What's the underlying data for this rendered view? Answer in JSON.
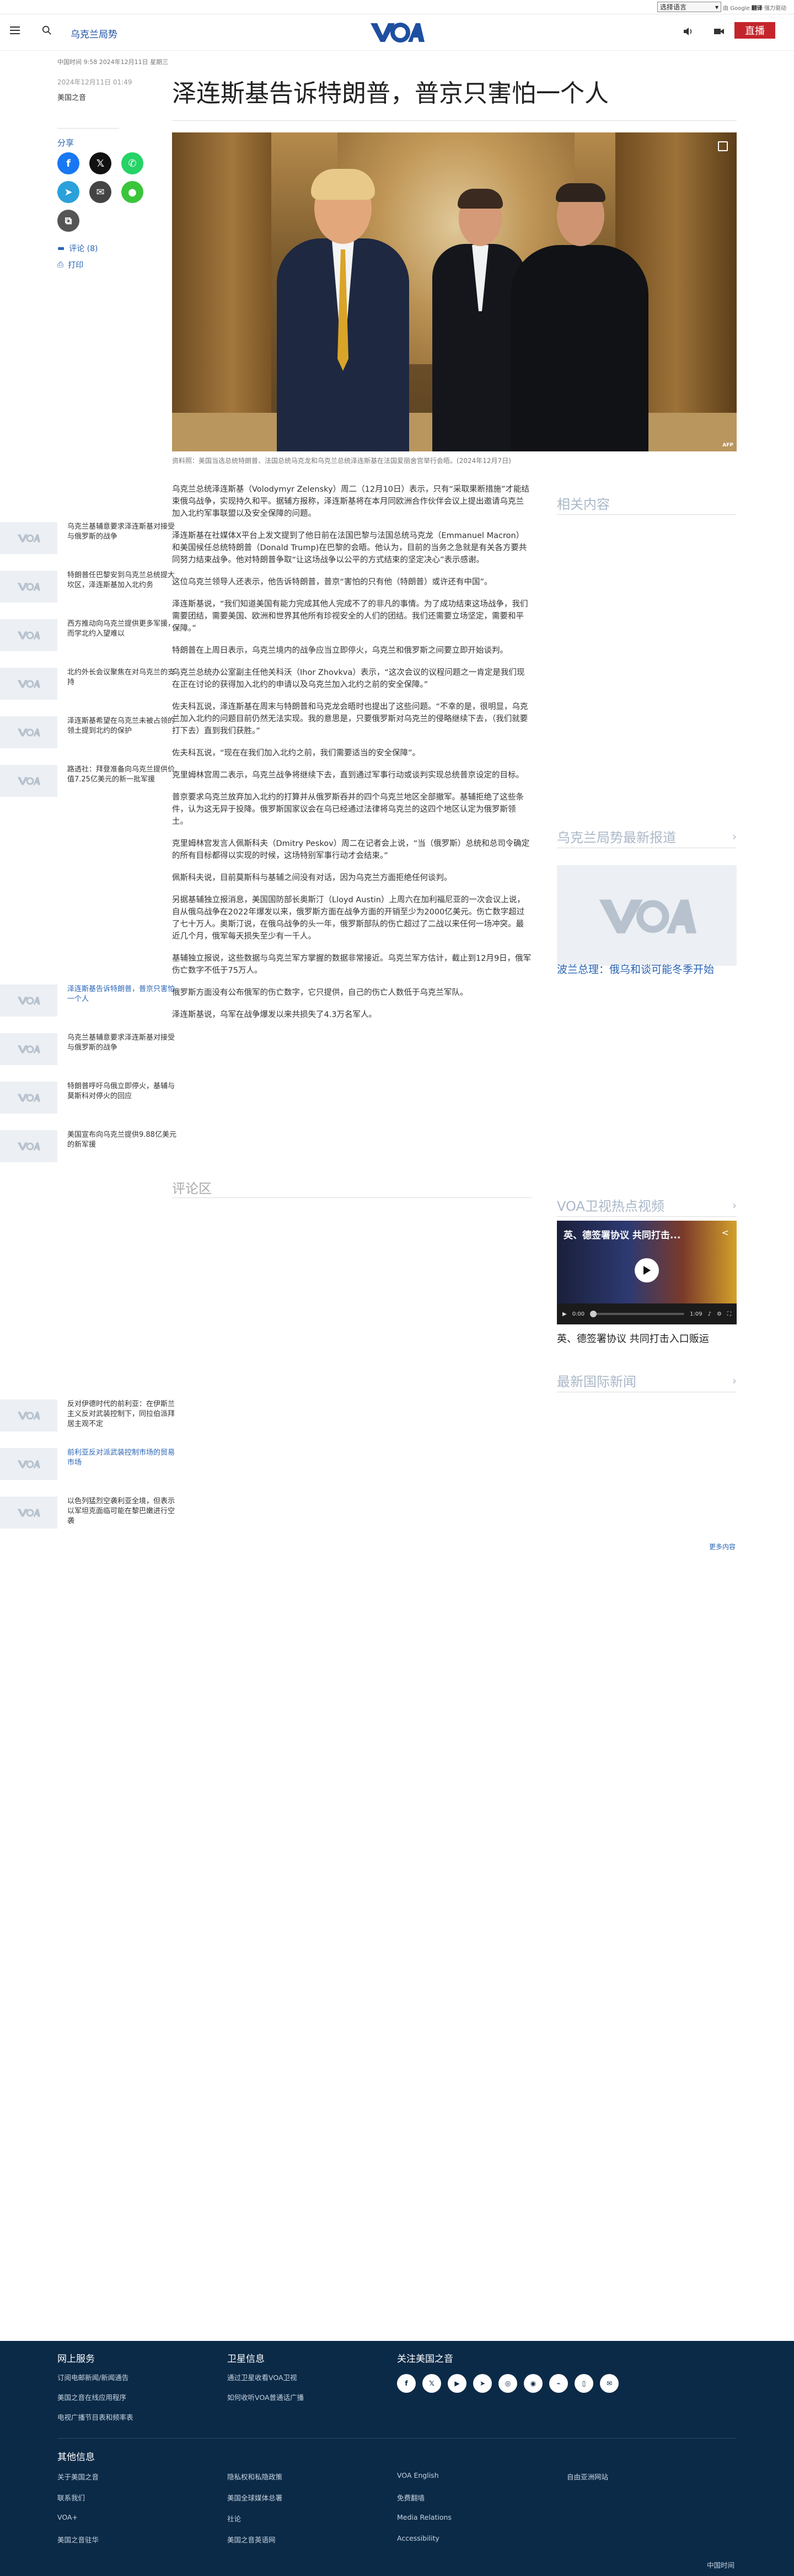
{
  "topbar": {
    "language_select": "选择语言",
    "gt_prefix": "由 Google",
    "gt_brand": "翻译",
    "gt_suffix": "强力驱动"
  },
  "header": {
    "section": "乌克兰局势",
    "live_label": "直播",
    "logo_text": "VOA"
  },
  "article": {
    "meta_line": "中国时间 9:58 2024年12月11日 星期三",
    "date": "2024年12月11日 01:49",
    "author": "美国之音",
    "headline": "泽连斯基告诉特朗普，普京只害怕一个人",
    "caption": "资料照：美国当选总统特朗普、法国总统马克龙和乌克兰总统泽连斯基在法国爱丽舍宫举行会晤。(2024年12月7日)",
    "paragraphs": [
      "乌克兰总统泽连斯基（Volodymyr Zelensky）周二（12月10日）表示，只有“采取果断措施”才能结束俄乌战争，实现持久和平。据辅方报称，泽连斯基将在本月同欧洲合作伙伴会议上提出邀请乌克兰加入北约军事联盟以及安全保障的问题。",
      "泽连斯基在社媒体X平台上发文提到了他日前在法国巴黎与法国总统马克龙（Emmanuel Macron）和美国候任总统特朗普（Donald Trump)在巴黎的会晤。他认为，目前的当务之急就是有关各方要共同努力结束战争。他对特朗普争取“让这场战争以公平的方式结束的坚定决心”表示感谢。",
      "这位乌克兰领导人还表示，他告诉特朗普，普京“害怕的只有他（特朗普）或许还有中国”。",
      "泽连斯基说，“我们知道美国有能力完成其他人完成不了的非凡的事情。为了成功结束这场战争，我们需要团结，需要美国、欧洲和世界其他所有珍视安全的人们的团结。我们还需要立场坚定，需要和平保障。”",
      "特朗普在上周日表示，乌克兰境内的战争应当立即停火，乌克兰和俄罗斯之间要立即开始谈判。",
      "乌克兰总统办公室副主任他关科沃（Ihor Zhovkva）表示，“这次会议的议程问题之一肯定是我们现在正在讨论的获得加入北约的申请以及乌克兰加入北约之前的安全保障。”",
      "佐夫科瓦说，泽连斯基在周末与特朗普和马克龙会晤时也提出了这些问题。“不幸的是，很明显，乌克兰加入北约的问题目前仍然无法实现。我的意思是，只要俄罗斯对乌克兰的侵略继续下去，（我们就要打下去）直到我们获胜。”",
      "佐夫科瓦说，“现在在我们加入北约之前，我们需要适当的安全保障”。",
      "克里姆林宫周二表示，乌克兰战争将继续下去，直到通过军事行动或谈判实现总统普京设定的目标。",
      "普京要求乌克兰放弃加入北约的打算并从俄罗斯吞并的四个乌克兰地区全部撤军。基辅拒绝了这些条件，认为这无异于投降。俄罗斯国家议会在乌已经通过法律将乌克兰的这四个地区认定为俄罗斯领土。",
      "克里姆林宫发言人佩斯科夫（Dmitry Peskov）周二在记者会上说，“当（俄罗斯）总统和总司令确定的所有目标都得以实现的时候，这场特别军事行动才会结束。”",
      "佩斯科夫说，目前莫斯科与基辅之间没有对话，因为乌克兰方面拒绝任何谈判。",
      "另据基辅独立报消息，美国国防部长奥斯汀（Lloyd Austin）上周六在加利福尼亚的一次会议上说，自从俄乌战争在2022年爆发以来，俄罗斯方面在战争方面的开销至少为2000亿美元。伤亡数字超过了七十万人。奥斯汀说，在俄乌战争的头一年，俄罗斯部队的伤亡超过了二战以来任何一场冲突。最近几个月，俄军每天损失至少有一千人。",
      "基辅独立报说，这些数据与乌克兰军方掌握的数据非常接近。乌克兰军方估计，截止到12月9日，俄军伤亡数字不低于75万人。",
      "俄罗斯方面没有公布俄军的伤亡数字，它只提供，自己的伤亡人数低于乌克兰军队。",
      "泽连斯基说，乌军在战争爆发以来共损失了4.3万名军人。"
    ],
    "comments_title": "评论区"
  },
  "sidebar_actions": {
    "share_label": "分享",
    "comment_label": "评论 (8)",
    "print_label": "打印"
  },
  "related": {
    "title": "相关内容",
    "items": [
      {
        "text": "乌克兰基辅意要求泽连斯基对接受与俄罗斯的战争"
      },
      {
        "text": "特朗普任巴黎安到乌克兰总统提大坎区，泽连斯基加入北约务"
      },
      {
        "text": "西方推动向乌克兰提供更多军援，而学北约入望难以"
      },
      {
        "text": "北约外长会议聚焦在对乌克兰的支持"
      },
      {
        "text": "泽连斯基希望在乌克兰未被占领的领土提到北约的保护"
      },
      {
        "text": "路透社：拜登准备向乌克兰提供价值7.25亿美元的新一批军援"
      }
    ]
  },
  "latest_ukraine": {
    "title": "乌克兰局势最新报道",
    "feature_title": "波兰总理：俄乌和谈可能冬季开始",
    "items": [
      {
        "text": "泽连斯基告诉特朗普，普京只害怕一个人",
        "blue": true
      },
      {
        "text": "乌克兰基辅意要求泽连斯基对接受与俄罗斯的战争",
        "blue": false
      },
      {
        "text": "特朗普呼吁乌俄立即停火，基辅与莫斯科对停火的回应",
        "blue": false
      },
      {
        "text": "美国宣布向乌克兰提供9.88亿美元的新军援",
        "blue": false
      }
    ]
  },
  "video": {
    "section_title": "VOA卫视热点视频",
    "frame_title": "英、德签署协议 共同打击...",
    "time_current": "0:00",
    "time_total": "1:09",
    "below_title": "英、德签署协议 共同打击入口贩运"
  },
  "intl": {
    "title": "最新国际新闻",
    "items": [
      {
        "text": "反对伊德时代的前利亚：在伊斯兰主义反对武装控制下，同拉伯派拜居主观不定"
      },
      {
        "text": "前利亚反对派武装控制市场的贸易市场"
      },
      {
        "text": "以色列猛烈空袭利亚全境，但表示以军坦克面临可能在黎巴嫩进行空袭"
      }
    ],
    "more": "更多内容"
  },
  "footer": {
    "col1_title": "网上服务",
    "col1_links": [
      "订阅电邮新闻/新闻通告",
      "美国之音在线应用程序",
      "电视广播节目表和频率表"
    ],
    "col2_title": "卫星信息",
    "col2_links": [
      "通过卫星收看VOA卫视",
      "如何收听VOA普通话广播"
    ],
    "col3_title": "关注美国之音",
    "other_title": "其他信息",
    "links_a": [
      "关于美国之音",
      "联系我们",
      "VOA+",
      "美国之音驻华"
    ],
    "links_b": [
      "隐私权和私隐政策",
      "美国全球媒体总署",
      "社论",
      "美国之音英语网"
    ],
    "links_c": [
      "VOA English",
      "免费翻墙",
      "Media Relations",
      "Accessibility"
    ],
    "links_d": [
      "自由亚洲网站"
    ],
    "bottom_time": "中国时间",
    "social_icons": [
      "facebook-icon",
      "x-icon",
      "youtube-icon",
      "telegram-icon",
      "instagram-icon",
      "podcast-icon",
      "rss-icon",
      "mobile-icon",
      "email-icon"
    ]
  },
  "colors": {
    "brand_blue": "#1e4fa1",
    "live_red": "#c4252c",
    "footer_bg": "#0b2a47"
  }
}
